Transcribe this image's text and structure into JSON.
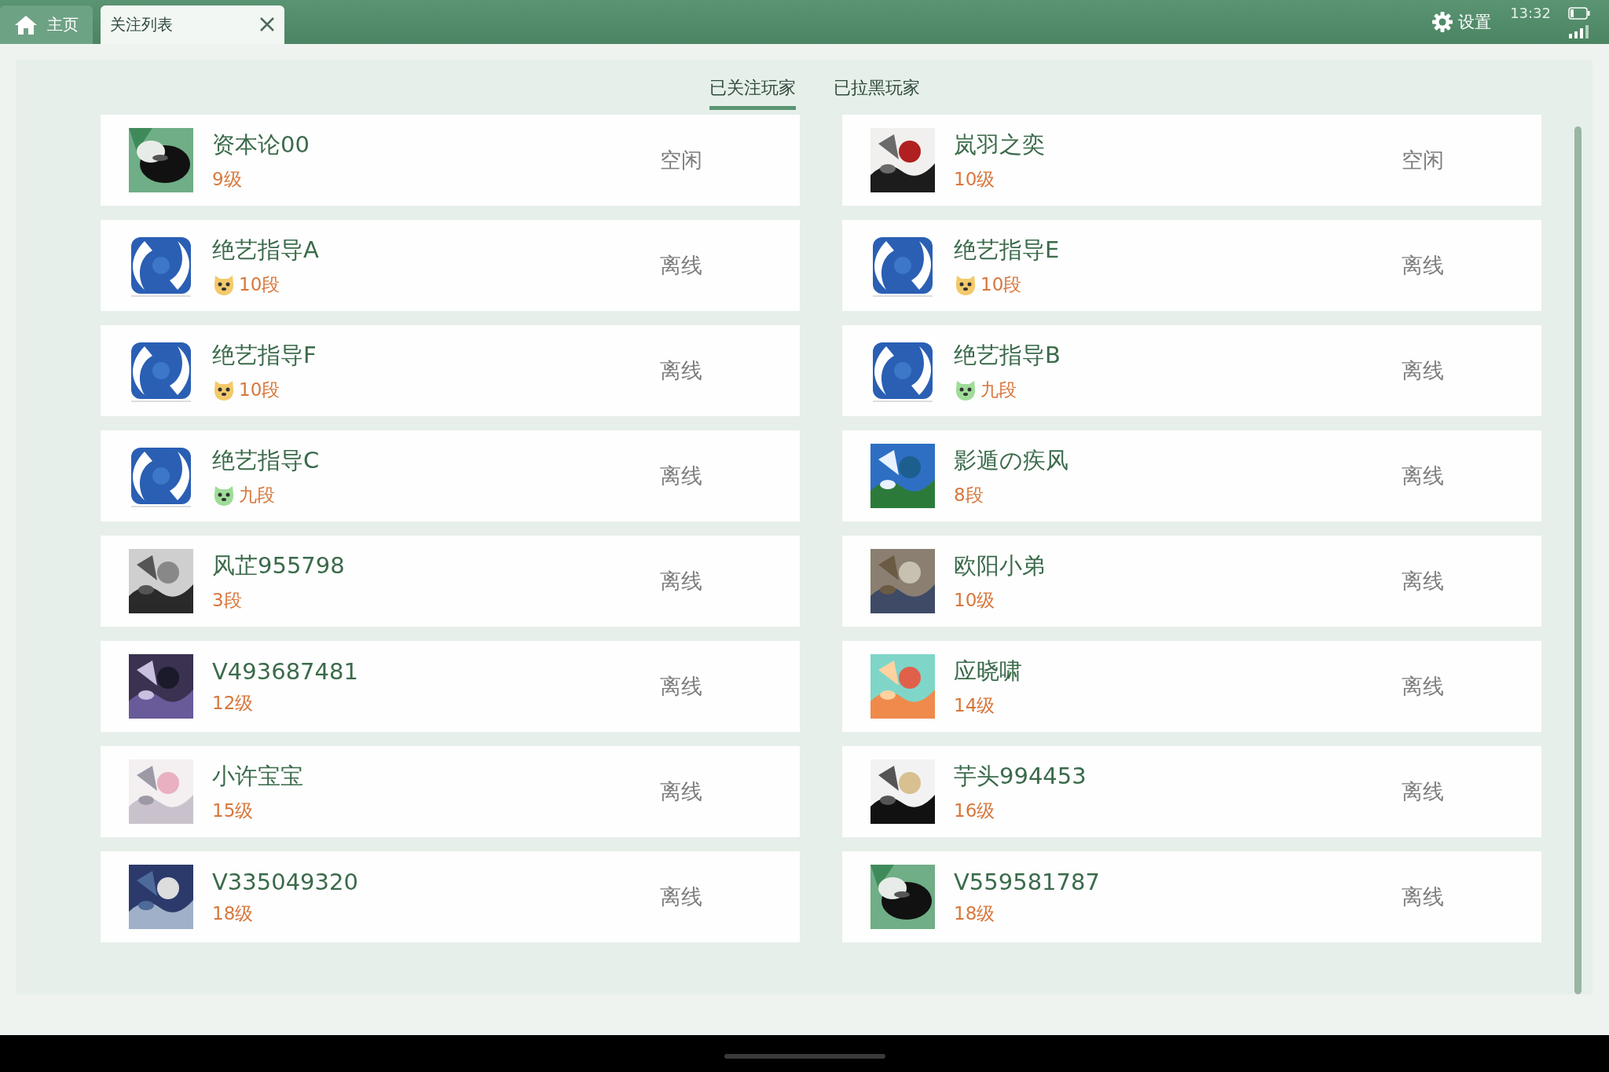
{
  "top_bar": {
    "tabs": [
      {
        "label": "主页",
        "kind": "home",
        "selected": false
      },
      {
        "label": "关注列表",
        "kind": "closable",
        "selected": true
      }
    ],
    "settings": "设置",
    "time": "13:32"
  },
  "tabs": [
    {
      "label": "已关注玩家",
      "selected": true
    },
    {
      "label": "已拉黑玩家",
      "selected": false
    }
  ],
  "players": [
    {
      "name": "资本论00",
      "level": "9级",
      "status": "空闲",
      "avatar": {
        "kind": "stone"
      }
    },
    {
      "name": "岚羽之奕",
      "level": "10级",
      "status": "空闲"
    },
    {
      "name": "绝艺指导A",
      "level": "10段",
      "status": "离线",
      "avatar": {
        "kind": "logo"
      },
      "badge": {
        "color": "#f3c96a"
      }
    },
    {
      "name": "绝艺指导E",
      "level": "10段",
      "status": "离线",
      "avatar": {
        "kind": "logo"
      },
      "badge": {
        "color": "#f3c96a"
      }
    },
    {
      "name": "绝艺指导F",
      "level": "10段",
      "status": "离线",
      "avatar": {
        "kind": "logo"
      },
      "badge": {
        "color": "#f3c96a"
      }
    },
    {
      "name": "绝艺指导B",
      "level": "九段",
      "status": "离线",
      "avatar": {
        "kind": "logo"
      },
      "badge": {
        "color": "#9fdc98"
      }
    },
    {
      "name": "绝艺指导C",
      "level": "九段",
      "status": "离线",
      "avatar": {
        "kind": "logo"
      },
      "badge": {
        "color": "#9fdc98"
      }
    },
    {
      "name": "影遁の疾风",
      "level": "8段",
      "status": "离线"
    },
    {
      "name": "风芷955798",
      "level": "3段",
      "status": "离线"
    },
    {
      "name": "欧阳小弟",
      "level": "10级",
      "status": "离线"
    },
    {
      "name": "V493687481",
      "level": "12级",
      "status": "离线"
    },
    {
      "name": "应晓啸",
      "level": "14级",
      "status": "离线"
    },
    {
      "name": "小许宝宝",
      "level": "15级",
      "status": "离线"
    },
    {
      "name": "芋头994453",
      "level": "16级",
      "status": "离线"
    },
    {
      "name": "V335049320",
      "level": "18级",
      "status": "离线"
    },
    {
      "name": "V559581787",
      "level": "18级",
      "status": "离线",
      "avatar": {
        "kind": "stone"
      }
    }
  ]
}
